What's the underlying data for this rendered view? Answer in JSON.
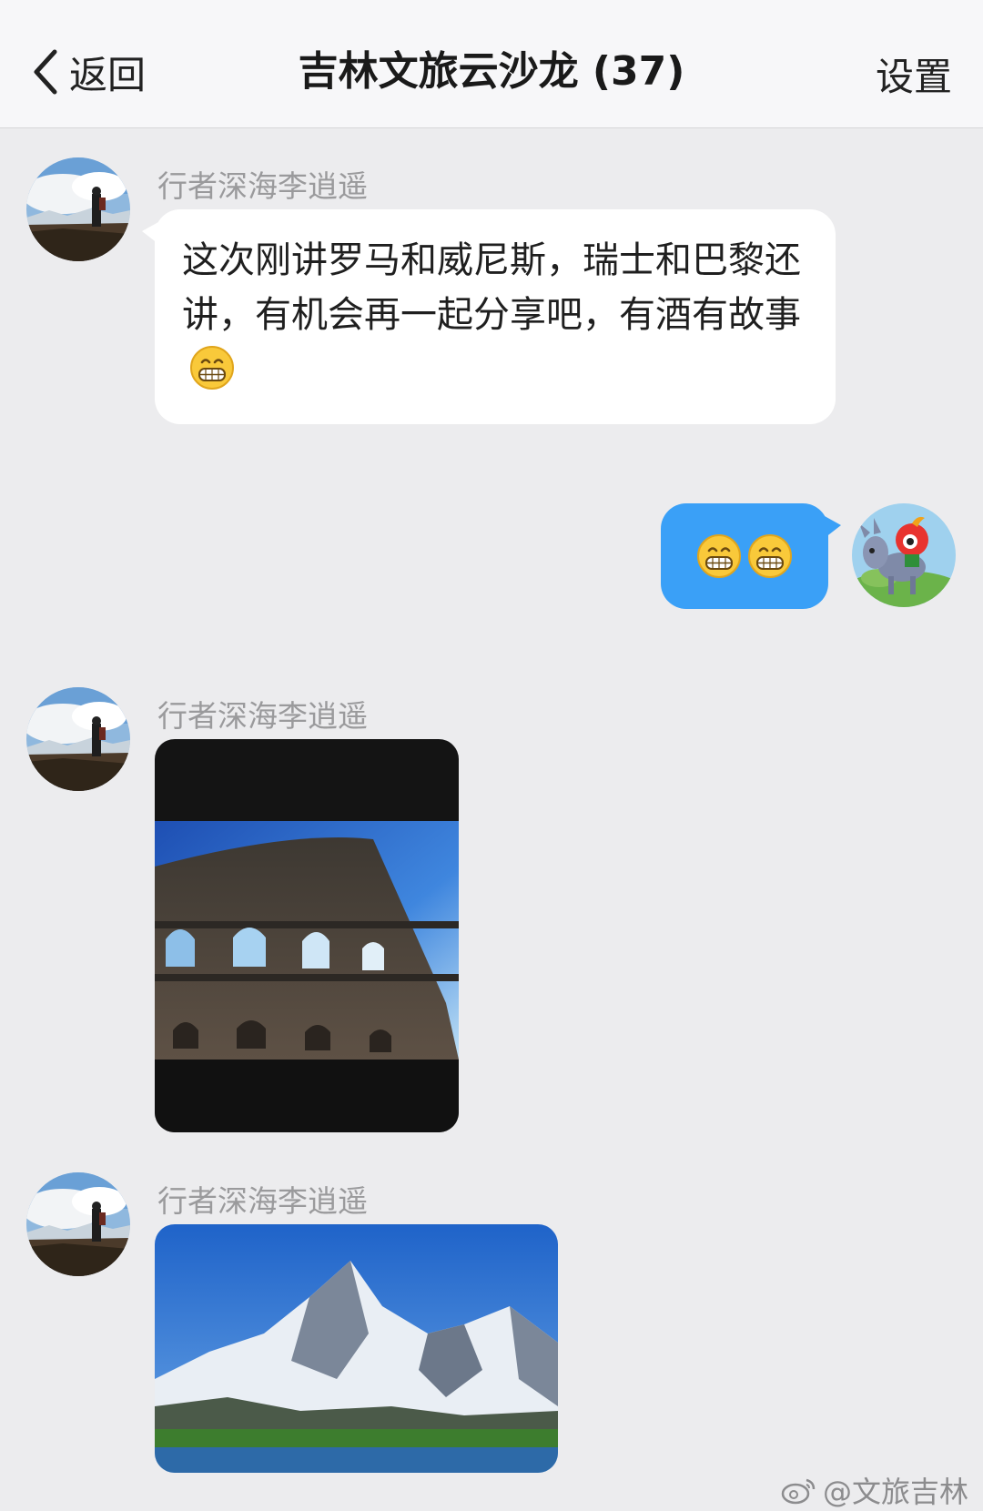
{
  "header": {
    "back_label": "返回",
    "title": "吉林文旅云沙龙 (37)",
    "settings_label": "设置"
  },
  "messages": [
    {
      "sender": "行者深海李逍遥",
      "text": "这次刚讲罗马和威尼斯，瑞士和巴黎还讲，有机会再一起分享吧，有酒有故事",
      "emoji": "grinning-face-icon"
    },
    {
      "sender": "self",
      "emoji": [
        "grinning-face-icon",
        "grinning-face-icon"
      ]
    },
    {
      "sender": "行者深海李逍遥",
      "image": "colosseum-photo"
    },
    {
      "sender": "行者深海李逍遥",
      "image": "snowy-mountain-photo"
    }
  ],
  "watermark": {
    "icon": "weibo-icon",
    "text": "@文旅吉林"
  },
  "colors": {
    "background": "#ececee",
    "nav_bg": "#f7f7f9",
    "self_bubble": "#3aa0f7",
    "sender_name": "#9a9a9c"
  }
}
